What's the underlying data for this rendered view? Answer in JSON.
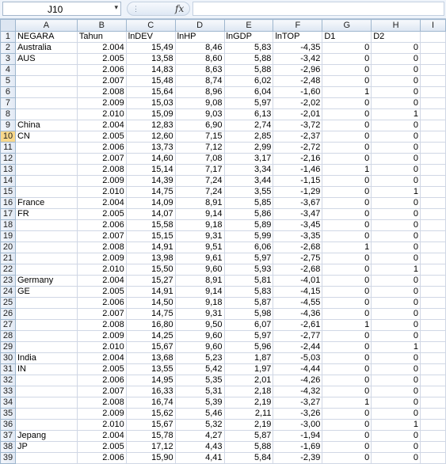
{
  "name_box": {
    "value": "J10",
    "arrow": "▾"
  },
  "formula": {
    "fx_label": "fx",
    "grip": "⋮",
    "content": ""
  },
  "columns": [
    "A",
    "B",
    "C",
    "D",
    "E",
    "F",
    "G",
    "H",
    "I"
  ],
  "rows": [
    {
      "n": "1",
      "c": [
        "NEGARA",
        "Tahun",
        "lnDEV",
        "lnHP",
        "lnGDP",
        "lnTOP",
        "D1",
        "D2",
        ""
      ]
    },
    {
      "n": "2",
      "c": [
        "Australia",
        "2.004",
        "15,49",
        "8,46",
        "5,83",
        "-4,35",
        "0",
        "0",
        ""
      ]
    },
    {
      "n": "3",
      "c": [
        "AUS",
        "2.005",
        "13,58",
        "8,60",
        "5,88",
        "-3,42",
        "0",
        "0",
        ""
      ]
    },
    {
      "n": "4",
      "c": [
        "",
        "2.006",
        "14,83",
        "8,63",
        "5,88",
        "-2,96",
        "0",
        "0",
        ""
      ]
    },
    {
      "n": "5",
      "c": [
        "",
        "2.007",
        "15,48",
        "8,74",
        "6,02",
        "-2,48",
        "0",
        "0",
        ""
      ]
    },
    {
      "n": "6",
      "c": [
        "",
        "2.008",
        "15,64",
        "8,96",
        "6,04",
        "-1,60",
        "1",
        "0",
        ""
      ]
    },
    {
      "n": "7",
      "c": [
        "",
        "2.009",
        "15,03",
        "9,08",
        "5,97",
        "-2,02",
        "0",
        "0",
        ""
      ]
    },
    {
      "n": "8",
      "c": [
        "",
        "2.010",
        "15,09",
        "9,03",
        "6,13",
        "-2,01",
        "0",
        "1",
        ""
      ]
    },
    {
      "n": "9",
      "c": [
        "China",
        "2.004",
        "12,83",
        "6,90",
        "2,74",
        "-3,72",
        "0",
        "0",
        ""
      ]
    },
    {
      "n": "10",
      "c": [
        "CN",
        "2.005",
        "12,60",
        "7,15",
        "2,85",
        "-2,37",
        "0",
        "0",
        ""
      ]
    },
    {
      "n": "11",
      "c": [
        "",
        "2.006",
        "13,73",
        "7,12",
        "2,99",
        "-2,72",
        "0",
        "0",
        ""
      ]
    },
    {
      "n": "12",
      "c": [
        "",
        "2.007",
        "14,60",
        "7,08",
        "3,17",
        "-2,16",
        "0",
        "0",
        ""
      ]
    },
    {
      "n": "13",
      "c": [
        "",
        "2.008",
        "15,14",
        "7,17",
        "3,34",
        "-1,46",
        "1",
        "0",
        ""
      ]
    },
    {
      "n": "14",
      "c": [
        "",
        "2.009",
        "14,39",
        "7,24",
        "3,44",
        "-1,15",
        "0",
        "0",
        ""
      ]
    },
    {
      "n": "15",
      "c": [
        "",
        "2.010",
        "14,75",
        "7,24",
        "3,55",
        "-1,29",
        "0",
        "1",
        ""
      ]
    },
    {
      "n": "16",
      "c": [
        "France",
        "2.004",
        "14,09",
        "8,91",
        "5,85",
        "-3,67",
        "0",
        "0",
        ""
      ]
    },
    {
      "n": "17",
      "c": [
        "FR",
        "2.005",
        "14,07",
        "9,14",
        "5,86",
        "-3,47",
        "0",
        "0",
        ""
      ]
    },
    {
      "n": "18",
      "c": [
        "",
        "2.006",
        "15,58",
        "9,18",
        "5,89",
        "-3,45",
        "0",
        "0",
        ""
      ]
    },
    {
      "n": "19",
      "c": [
        "",
        "2.007",
        "15,15",
        "9,31",
        "5,99",
        "-3,35",
        "0",
        "0",
        ""
      ]
    },
    {
      "n": "20",
      "c": [
        "",
        "2.008",
        "14,91",
        "9,51",
        "6,06",
        "-2,68",
        "1",
        "0",
        ""
      ]
    },
    {
      "n": "21",
      "c": [
        "",
        "2.009",
        "13,98",
        "9,61",
        "5,97",
        "-2,75",
        "0",
        "0",
        ""
      ]
    },
    {
      "n": "22",
      "c": [
        "",
        "2.010",
        "15,50",
        "9,60",
        "5,93",
        "-2,68",
        "0",
        "1",
        ""
      ]
    },
    {
      "n": "23",
      "c": [
        "Germany",
        "2.004",
        "15,27",
        "8,91",
        "5,81",
        "-4,01",
        "0",
        "0",
        ""
      ]
    },
    {
      "n": "24",
      "c": [
        "GE",
        "2.005",
        "14,91",
        "9,14",
        "5,83",
        "-4,15",
        "0",
        "0",
        ""
      ]
    },
    {
      "n": "25",
      "c": [
        "",
        "2.006",
        "14,50",
        "9,18",
        "5,87",
        "-4,55",
        "0",
        "0",
        ""
      ]
    },
    {
      "n": "26",
      "c": [
        "",
        "2.007",
        "14,75",
        "9,31",
        "5,98",
        "-4,36",
        "0",
        "0",
        ""
      ]
    },
    {
      "n": "27",
      "c": [
        "",
        "2.008",
        "16,80",
        "9,50",
        "6,07",
        "-2,61",
        "1",
        "0",
        ""
      ]
    },
    {
      "n": "28",
      "c": [
        "",
        "2.009",
        "14,25",
        "9,60",
        "5,97",
        "-2,77",
        "0",
        "0",
        ""
      ]
    },
    {
      "n": "29",
      "c": [
        "",
        "2.010",
        "15,67",
        "9,60",
        "5,96",
        "-2,44",
        "0",
        "1",
        ""
      ]
    },
    {
      "n": "30",
      "c": [
        "India",
        "2.004",
        "13,68",
        "5,23",
        "1,87",
        "-5,03",
        "0",
        "0",
        ""
      ]
    },
    {
      "n": "31",
      "c": [
        "IN",
        "2.005",
        "13,55",
        "5,42",
        "1,97",
        "-4,44",
        "0",
        "0",
        ""
      ]
    },
    {
      "n": "32",
      "c": [
        "",
        "2.006",
        "14,95",
        "5,35",
        "2,01",
        "-4,26",
        "0",
        "0",
        ""
      ]
    },
    {
      "n": "33",
      "c": [
        "",
        "2.007",
        "16,33",
        "5,31",
        "2,18",
        "-4,32",
        "0",
        "0",
        ""
      ]
    },
    {
      "n": "34",
      "c": [
        "",
        "2.008",
        "16,74",
        "5,39",
        "2,19",
        "-3,27",
        "1",
        "0",
        ""
      ]
    },
    {
      "n": "35",
      "c": [
        "",
        "2.009",
        "15,62",
        "5,46",
        "2,11",
        "-3,26",
        "0",
        "0",
        ""
      ]
    },
    {
      "n": "36",
      "c": [
        "",
        "2.010",
        "15,67",
        "5,32",
        "2,19",
        "-3,00",
        "0",
        "1",
        ""
      ]
    },
    {
      "n": "37",
      "c": [
        "Jepang",
        "2.004",
        "15,78",
        "4,27",
        "5,87",
        "-1,94",
        "0",
        "0",
        ""
      ]
    },
    {
      "n": "38",
      "c": [
        "JP",
        "2.005",
        "17,12",
        "4,43",
        "5,88",
        "-1,69",
        "0",
        "0",
        ""
      ]
    },
    {
      "n": "39",
      "c": [
        "",
        "2.006",
        "15,90",
        "4,41",
        "5,84",
        "-2,39",
        "0",
        "0",
        ""
      ]
    }
  ],
  "active_cell": {
    "row": "10",
    "column": "J"
  }
}
